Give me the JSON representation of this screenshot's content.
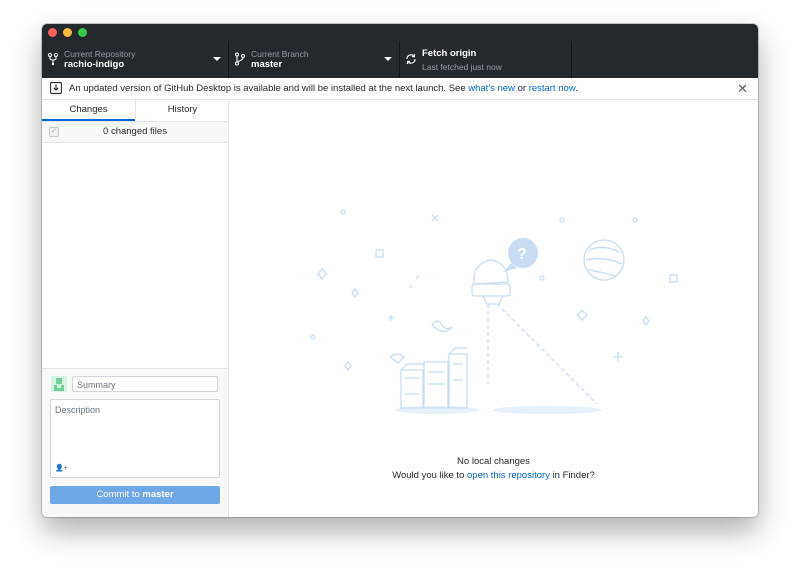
{
  "toolbar": {
    "repo_label": "Current Repository",
    "repo_value": "rachio-indigo",
    "branch_label": "Current Branch",
    "branch_value": "master",
    "fetch_label": "Fetch origin",
    "fetch_sub": "Last fetched just now"
  },
  "banner": {
    "text": "An updated version of GitHub Desktop is available and will be installed at the next launch. See",
    "link1": "what's new",
    "or": "or",
    "link2": "restart now",
    "dot": ".",
    "close": "✕"
  },
  "sidebar": {
    "tabs": [
      "Changes",
      "History"
    ],
    "changed_files": "0 changed files",
    "summary_placeholder": "Summary",
    "description_placeholder": "Description",
    "commit_prefix": "Commit to",
    "commit_branch": "master"
  },
  "main": {
    "no_changes": "No local changes",
    "prompt_pre": "Would you like to",
    "prompt_link": "open this repository",
    "prompt_post": "in Finder?"
  },
  "icons": {
    "repo": "repo-icon",
    "branch": "branch-icon",
    "fetch": "sync-icon",
    "banner": "download-icon",
    "close": "close-icon"
  },
  "colors": {
    "toolbar_bg": "#24292e",
    "link": "#0366d6",
    "commit_button": "#6fa8e6",
    "illustration": "#c8ddf2"
  }
}
